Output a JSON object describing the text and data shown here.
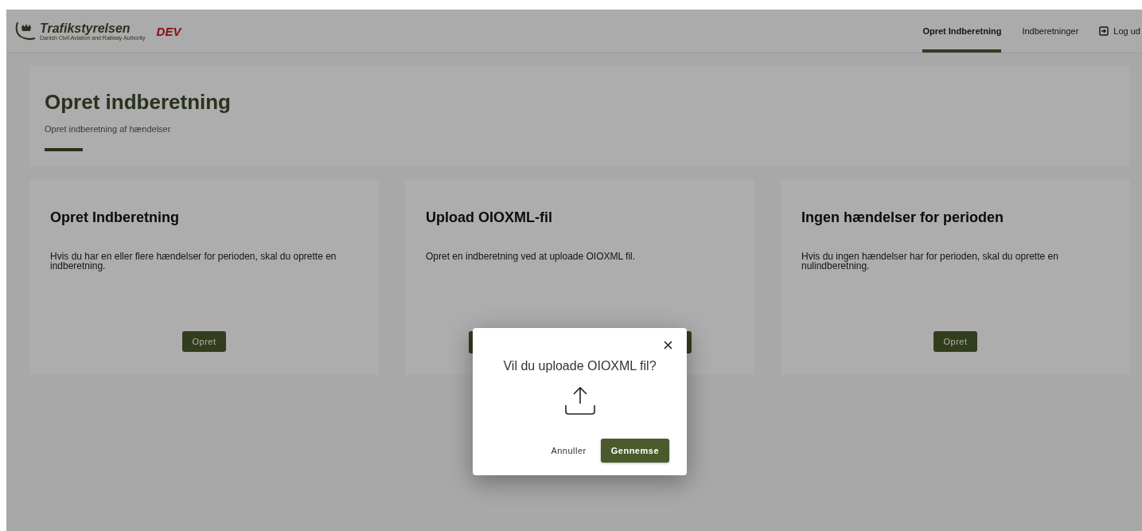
{
  "header": {
    "logo": {
      "name": "Trafikstyrelsen",
      "tagline": "Danish Civil Aviation and Railway Authority"
    },
    "environment": "DEV",
    "nav": [
      {
        "label": "Opret Indberetning",
        "selected": true
      },
      {
        "label": "Indberetninger",
        "selected": false
      }
    ],
    "logout": "Log ud"
  },
  "page_header": {
    "title": "Opret indberetning",
    "subtitle": "Opret indberetning af hændelser"
  },
  "cards": [
    {
      "kind": "button",
      "title": "Opret Indberetning",
      "text": "Hvis du har en eller flere hændelser for perioden, skal du oprette en indberetning.",
      "button": "Opret"
    },
    {
      "kind": "upload",
      "title": "Upload OIOXML-fil",
      "text": "Opret en indberetning ved at uploade OIOXML fil."
    },
    {
      "kind": "button",
      "title": "Ingen hændelser for perioden",
      "text": "Hvis du ingen hændelser har for perioden, skal du oprette en nulindberetning.",
      "button": "Opret"
    }
  ],
  "dialog": {
    "question": "Vil du uploade OIOXML fil?",
    "buttons": [
      {
        "label": "Annuller",
        "kind": "text"
      },
      {
        "label": "Gennemse",
        "kind": "primary"
      }
    ]
  }
}
